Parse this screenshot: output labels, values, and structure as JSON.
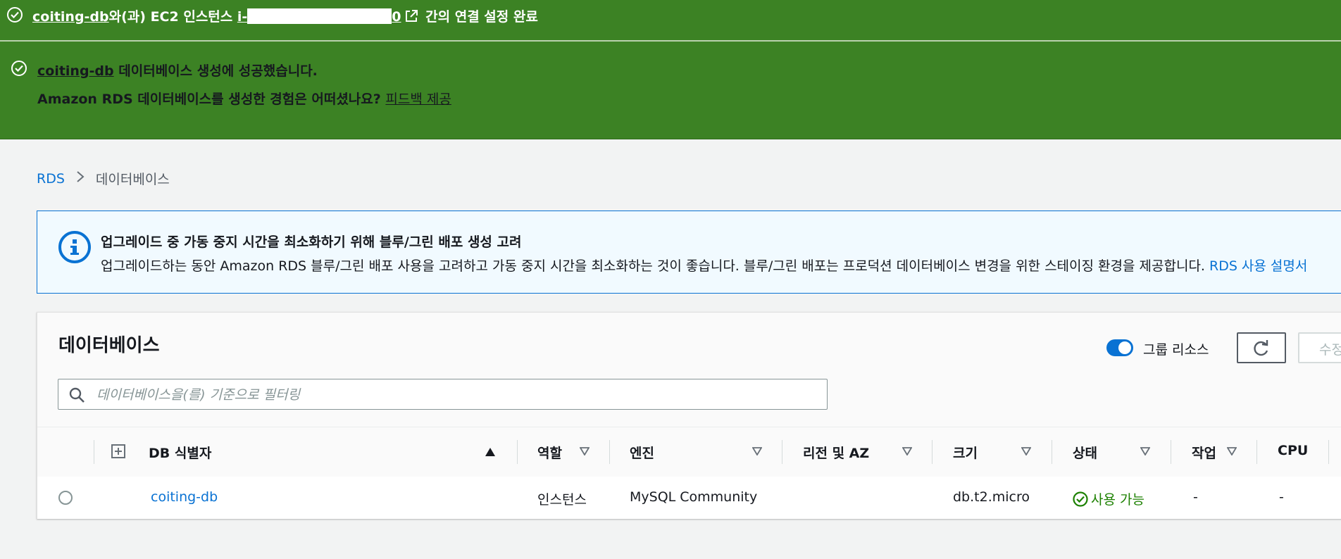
{
  "flash_connect": {
    "db_link": "coiting-db",
    "middle_text": "와(과) EC2 인스턴스 ",
    "instance_prefix": "i-",
    "instance_suffix": "0",
    "suffix_text": " 간의 연결 설정 완료"
  },
  "flash_created": {
    "db_link": "coiting-db",
    "line1_text": " 데이터베이스 생성에 성공했습니다.",
    "line2_text": "Amazon RDS 데이터베이스를 생성한 경험은 어떠셨나요? ",
    "feedback_link": "피드백 제공"
  },
  "breadcrumb": {
    "root": "RDS",
    "current": "데이터베이스"
  },
  "info_alert": {
    "title": "업그레이드 중 가동 중지 시간을 최소화하기 위해 블루/그린 배포 생성 고려",
    "body": "업그레이드하는 동안 Amazon RDS 블루/그린 배포 사용을 고려하고 가동 중지 시간을 최소화하는 것이 좋습니다. 블루/그린 배포는 프로덕션 데이터베이스 변경을 위한 스테이징 환경을 제공합니다. ",
    "link": "RDS 사용 설명서"
  },
  "databases_panel": {
    "title": "데이터베이스",
    "group_toggle_label": "그룹 리소스",
    "group_toggle_on": true,
    "edit_button": "수정",
    "search_placeholder": "데이터베이스을(를) 기준으로 필터링",
    "columns": {
      "db_id": "DB 식별자",
      "role": "역할",
      "engine": "엔진",
      "region_az": "리전 및 AZ",
      "size": "크기",
      "status": "상태",
      "actions": "작업",
      "cpu": "CPU"
    },
    "rows": [
      {
        "db_id": "coiting-db",
        "role": "인스턴스",
        "engine": "MySQL Community",
        "region_az": "",
        "size": "db.t2.micro",
        "status": "사용 가능",
        "actions": "-",
        "cpu": "-"
      }
    ]
  },
  "colors": {
    "success_green": "#3c8224",
    "link_blue": "#0972d3",
    "status_available": "#1d8102"
  }
}
